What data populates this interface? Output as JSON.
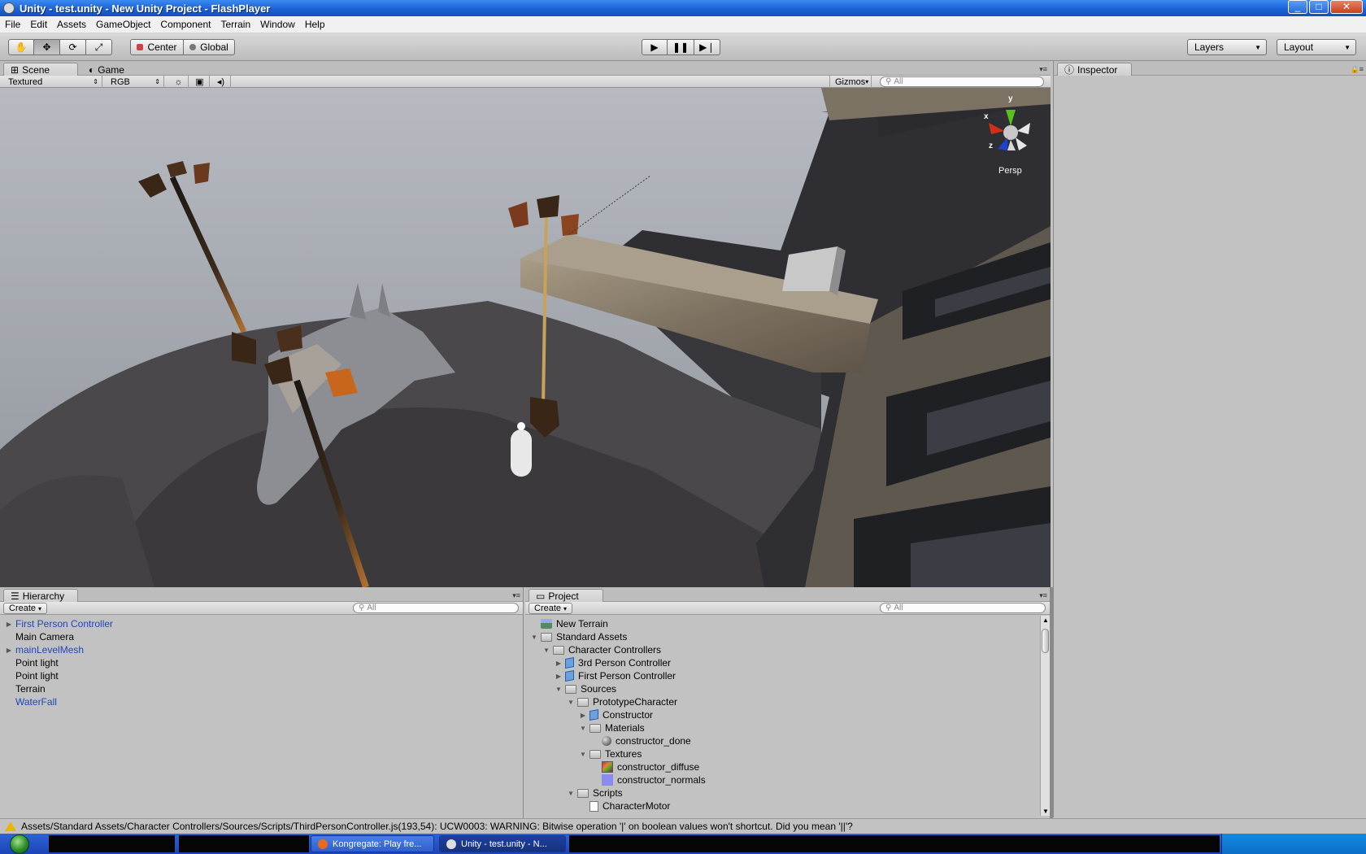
{
  "window": {
    "title": "Unity - test.unity - New Unity Project - FlashPlayer"
  },
  "menu": [
    "File",
    "Edit",
    "Assets",
    "GameObject",
    "Component",
    "Terrain",
    "Window",
    "Help"
  ],
  "toolbar": {
    "pivot_label": "Center",
    "space_label": "Global",
    "layers_label": "Layers",
    "layout_label": "Layout"
  },
  "tabs": {
    "scene": "Scene",
    "game": "Game",
    "inspector": "Inspector",
    "hierarchy": "Hierarchy",
    "project": "Project"
  },
  "scene": {
    "render_mode": "Textured",
    "color_mode": "RGB",
    "gizmos_label": "Gizmos",
    "search_placeholder": "All",
    "view_label": "Persp",
    "axis_x": "x",
    "axis_y": "y",
    "axis_z": "z"
  },
  "hierarchy": {
    "create_label": "Create",
    "search_placeholder": "All",
    "items": [
      {
        "label": "First Person Controller",
        "expandable": true,
        "prefab": true
      },
      {
        "label": "Main Camera",
        "expandable": false,
        "prefab": false
      },
      {
        "label": "mainLevelMesh",
        "expandable": true,
        "prefab": true
      },
      {
        "label": "Point light",
        "expandable": false,
        "prefab": false
      },
      {
        "label": "Point light",
        "expandable": false,
        "prefab": false
      },
      {
        "label": "Terrain",
        "expandable": false,
        "prefab": false
      },
      {
        "label": "WaterFall",
        "expandable": false,
        "prefab": true
      }
    ]
  },
  "project": {
    "create_label": "Create",
    "search_placeholder": "All",
    "items": [
      {
        "label": "New Terrain",
        "depth": 0,
        "icon": "terrain-icon",
        "toggle": ""
      },
      {
        "label": "Standard Assets",
        "depth": 0,
        "icon": "folder-icon",
        "toggle": "open"
      },
      {
        "label": "Character Controllers",
        "depth": 1,
        "icon": "folder-icon",
        "toggle": "open"
      },
      {
        "label": "3rd Person Controller",
        "depth": 2,
        "icon": "prefab-icon",
        "toggle": "closed"
      },
      {
        "label": "First Person Controller",
        "depth": 2,
        "icon": "prefab-icon",
        "toggle": "closed"
      },
      {
        "label": "Sources",
        "depth": 2,
        "icon": "folder-icon",
        "toggle": "open"
      },
      {
        "label": "PrototypeCharacter",
        "depth": 3,
        "icon": "folder-icon",
        "toggle": "open"
      },
      {
        "label": "Constructor",
        "depth": 4,
        "icon": "model-icon",
        "toggle": "closed"
      },
      {
        "label": "Materials",
        "depth": 4,
        "icon": "folder-icon",
        "toggle": "open"
      },
      {
        "label": "constructor_done",
        "depth": 5,
        "icon": "material-icon",
        "toggle": ""
      },
      {
        "label": "Textures",
        "depth": 4,
        "icon": "folder-icon",
        "toggle": "open"
      },
      {
        "label": "constructor_diffuse",
        "depth": 5,
        "icon": "texture-diffuse-icon",
        "toggle": ""
      },
      {
        "label": "constructor_normals",
        "depth": 5,
        "icon": "texture-normal-icon",
        "toggle": ""
      },
      {
        "label": "Scripts",
        "depth": 3,
        "icon": "folder-icon",
        "toggle": "open"
      },
      {
        "label": "CharacterMotor",
        "depth": 4,
        "icon": "script-icon",
        "toggle": ""
      }
    ]
  },
  "status": {
    "message": "Assets/Standard Assets/Character Controllers/Sources/Scripts/ThirdPersonController.js(193,54): UCW0003: WARNING: Bitwise operation '|' on boolean values won't shortcut. Did you mean '||'?"
  },
  "taskbar": {
    "tasks": [
      "Kongregate: Play fre...",
      "Unity - test.unity - N..."
    ]
  },
  "colors": {
    "prefab_text": "#2045b8",
    "title_bar": "#1a5fd6",
    "warning": "#e6b800"
  }
}
